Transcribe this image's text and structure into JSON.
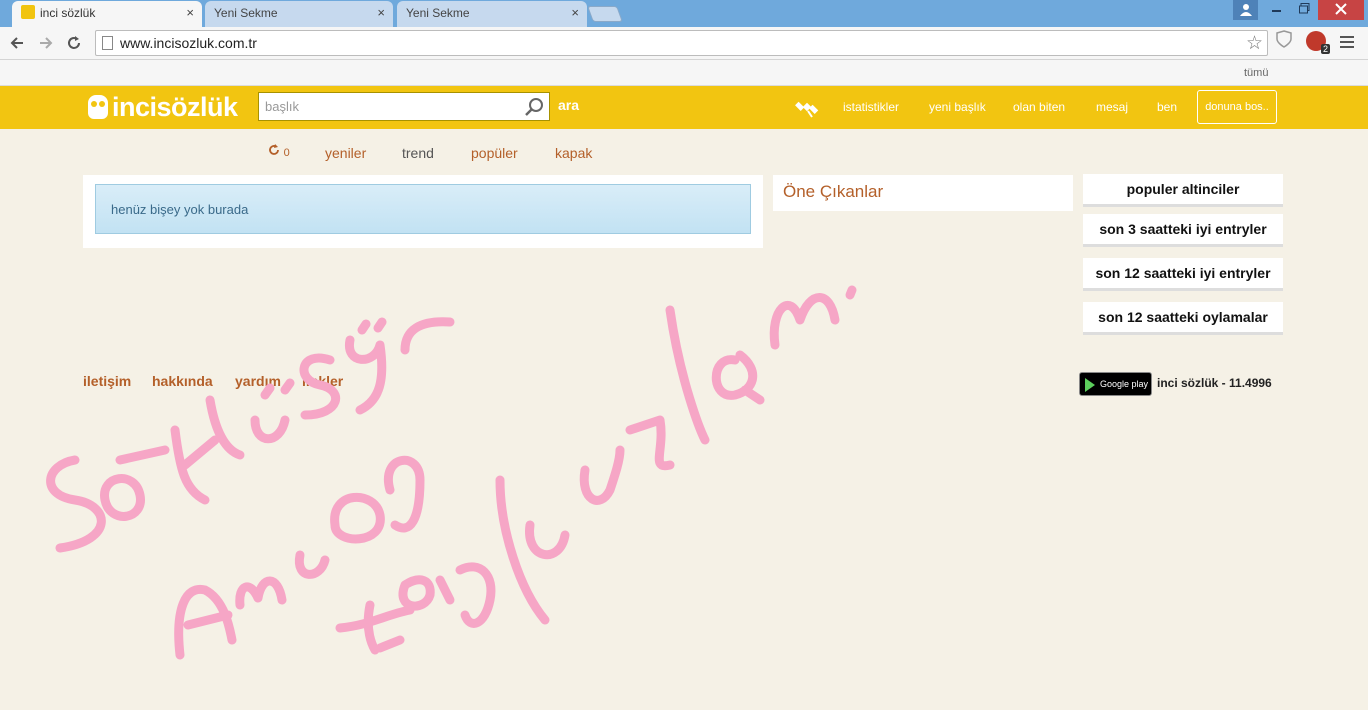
{
  "browser": {
    "tabs": [
      {
        "title": "inci sözlük",
        "active": true
      },
      {
        "title": "Yeni Sekme",
        "active": false
      },
      {
        "title": "Yeni Sekme",
        "active": false
      }
    ],
    "tab_close_glyph": "×",
    "url": "www.incisozluk.com.tr",
    "bookmarks_label": "tümü",
    "extension_badge": "2"
  },
  "site": {
    "logo": "incisözlük",
    "search": {
      "placeholder": "başlık",
      "button": "ara"
    },
    "nav": [
      "istatistikler",
      "yeni başlık",
      "olan biten",
      "mesaj",
      "ben"
    ],
    "cta": "donuna bos..",
    "refresh_count": "0",
    "subnav": [
      "yeniler",
      "trend",
      "popüler",
      "kapak"
    ],
    "notice": "henüz bişey yok burada",
    "featured_title": "Öne Çıkanlar",
    "sidebar": [
      "populer altinciler",
      "son 3 saatteki iyi entryler",
      "son 12 saatteki iyi entryler",
      "son 12 saatteki oylamalar"
    ],
    "footer": [
      "iletişim",
      "hakkında",
      "yardım",
      "linkler"
    ],
    "gplay_label": "Google play",
    "version": "inci sözlük - 11.4996"
  },
  "colors": {
    "brand": "#f2c511",
    "link": "#b4602a",
    "scribble": "#f6a6c6"
  },
  "icons": {
    "refresh": "refresh-icon",
    "satellite": "satellite-icon",
    "search": "magnifier-icon"
  }
}
